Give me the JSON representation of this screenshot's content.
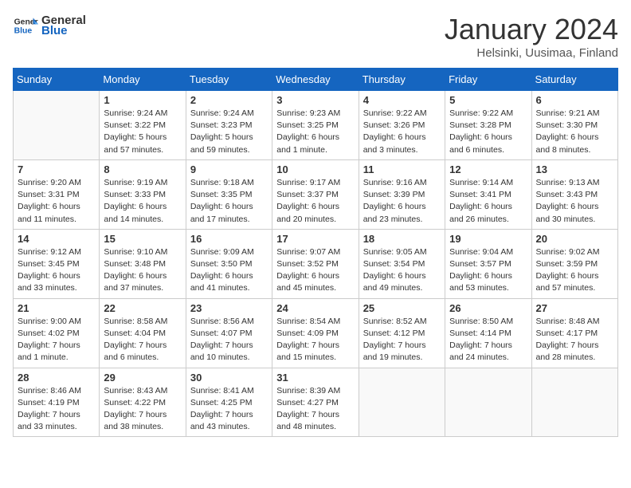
{
  "header": {
    "logo_general": "General",
    "logo_blue": "Blue",
    "month_title": "January 2024",
    "location": "Helsinki, Uusimaa, Finland"
  },
  "days_of_week": [
    "Sunday",
    "Monday",
    "Tuesday",
    "Wednesday",
    "Thursday",
    "Friday",
    "Saturday"
  ],
  "weeks": [
    [
      {
        "day": "",
        "info": ""
      },
      {
        "day": "1",
        "info": "Sunrise: 9:24 AM\nSunset: 3:22 PM\nDaylight: 5 hours\nand 57 minutes."
      },
      {
        "day": "2",
        "info": "Sunrise: 9:24 AM\nSunset: 3:23 PM\nDaylight: 5 hours\nand 59 minutes."
      },
      {
        "day": "3",
        "info": "Sunrise: 9:23 AM\nSunset: 3:25 PM\nDaylight: 6 hours\nand 1 minute."
      },
      {
        "day": "4",
        "info": "Sunrise: 9:22 AM\nSunset: 3:26 PM\nDaylight: 6 hours\nand 3 minutes."
      },
      {
        "day": "5",
        "info": "Sunrise: 9:22 AM\nSunset: 3:28 PM\nDaylight: 6 hours\nand 6 minutes."
      },
      {
        "day": "6",
        "info": "Sunrise: 9:21 AM\nSunset: 3:30 PM\nDaylight: 6 hours\nand 8 minutes."
      }
    ],
    [
      {
        "day": "7",
        "info": "Sunrise: 9:20 AM\nSunset: 3:31 PM\nDaylight: 6 hours\nand 11 minutes."
      },
      {
        "day": "8",
        "info": "Sunrise: 9:19 AM\nSunset: 3:33 PM\nDaylight: 6 hours\nand 14 minutes."
      },
      {
        "day": "9",
        "info": "Sunrise: 9:18 AM\nSunset: 3:35 PM\nDaylight: 6 hours\nand 17 minutes."
      },
      {
        "day": "10",
        "info": "Sunrise: 9:17 AM\nSunset: 3:37 PM\nDaylight: 6 hours\nand 20 minutes."
      },
      {
        "day": "11",
        "info": "Sunrise: 9:16 AM\nSunset: 3:39 PM\nDaylight: 6 hours\nand 23 minutes."
      },
      {
        "day": "12",
        "info": "Sunrise: 9:14 AM\nSunset: 3:41 PM\nDaylight: 6 hours\nand 26 minutes."
      },
      {
        "day": "13",
        "info": "Sunrise: 9:13 AM\nSunset: 3:43 PM\nDaylight: 6 hours\nand 30 minutes."
      }
    ],
    [
      {
        "day": "14",
        "info": "Sunrise: 9:12 AM\nSunset: 3:45 PM\nDaylight: 6 hours\nand 33 minutes."
      },
      {
        "day": "15",
        "info": "Sunrise: 9:10 AM\nSunset: 3:48 PM\nDaylight: 6 hours\nand 37 minutes."
      },
      {
        "day": "16",
        "info": "Sunrise: 9:09 AM\nSunset: 3:50 PM\nDaylight: 6 hours\nand 41 minutes."
      },
      {
        "day": "17",
        "info": "Sunrise: 9:07 AM\nSunset: 3:52 PM\nDaylight: 6 hours\nand 45 minutes."
      },
      {
        "day": "18",
        "info": "Sunrise: 9:05 AM\nSunset: 3:54 PM\nDaylight: 6 hours\nand 49 minutes."
      },
      {
        "day": "19",
        "info": "Sunrise: 9:04 AM\nSunset: 3:57 PM\nDaylight: 6 hours\nand 53 minutes."
      },
      {
        "day": "20",
        "info": "Sunrise: 9:02 AM\nSunset: 3:59 PM\nDaylight: 6 hours\nand 57 minutes."
      }
    ],
    [
      {
        "day": "21",
        "info": "Sunrise: 9:00 AM\nSunset: 4:02 PM\nDaylight: 7 hours\nand 1 minute."
      },
      {
        "day": "22",
        "info": "Sunrise: 8:58 AM\nSunset: 4:04 PM\nDaylight: 7 hours\nand 6 minutes."
      },
      {
        "day": "23",
        "info": "Sunrise: 8:56 AM\nSunset: 4:07 PM\nDaylight: 7 hours\nand 10 minutes."
      },
      {
        "day": "24",
        "info": "Sunrise: 8:54 AM\nSunset: 4:09 PM\nDaylight: 7 hours\nand 15 minutes."
      },
      {
        "day": "25",
        "info": "Sunrise: 8:52 AM\nSunset: 4:12 PM\nDaylight: 7 hours\nand 19 minutes."
      },
      {
        "day": "26",
        "info": "Sunrise: 8:50 AM\nSunset: 4:14 PM\nDaylight: 7 hours\nand 24 minutes."
      },
      {
        "day": "27",
        "info": "Sunrise: 8:48 AM\nSunset: 4:17 PM\nDaylight: 7 hours\nand 28 minutes."
      }
    ],
    [
      {
        "day": "28",
        "info": "Sunrise: 8:46 AM\nSunset: 4:19 PM\nDaylight: 7 hours\nand 33 minutes."
      },
      {
        "day": "29",
        "info": "Sunrise: 8:43 AM\nSunset: 4:22 PM\nDaylight: 7 hours\nand 38 minutes."
      },
      {
        "day": "30",
        "info": "Sunrise: 8:41 AM\nSunset: 4:25 PM\nDaylight: 7 hours\nand 43 minutes."
      },
      {
        "day": "31",
        "info": "Sunrise: 8:39 AM\nSunset: 4:27 PM\nDaylight: 7 hours\nand 48 minutes."
      },
      {
        "day": "",
        "info": ""
      },
      {
        "day": "",
        "info": ""
      },
      {
        "day": "",
        "info": ""
      }
    ]
  ]
}
